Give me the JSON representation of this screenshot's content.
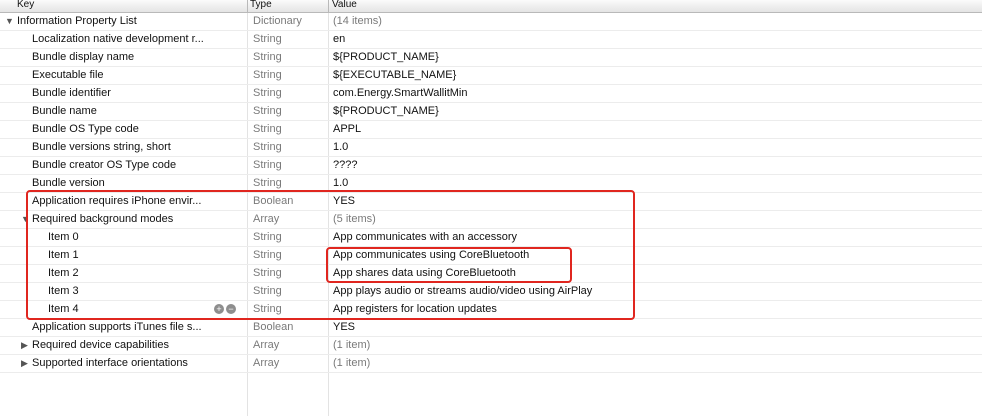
{
  "columns": {
    "key": "Key",
    "type": "Type",
    "value": "Value"
  },
  "rows": [
    {
      "key": "Information Property List",
      "type": "Dictionary",
      "value": "(14 items)"
    },
    {
      "key": "Localization native development r...",
      "type": "String",
      "value": "en"
    },
    {
      "key": "Bundle display name",
      "type": "String",
      "value": "${PRODUCT_NAME}"
    },
    {
      "key": "Executable file",
      "type": "String",
      "value": "${EXECUTABLE_NAME}"
    },
    {
      "key": "Bundle identifier",
      "type": "String",
      "value": "com.Energy.SmartWallitMin"
    },
    {
      "key": "Bundle name",
      "type": "String",
      "value": "${PRODUCT_NAME}"
    },
    {
      "key": "Bundle OS Type code",
      "type": "String",
      "value": "APPL"
    },
    {
      "key": "Bundle versions string, short",
      "type": "String",
      "value": "1.0"
    },
    {
      "key": "Bundle creator OS Type code",
      "type": "String",
      "value": "????"
    },
    {
      "key": "Bundle version",
      "type": "String",
      "value": "1.0"
    },
    {
      "key": "Application requires iPhone envir...",
      "type": "Boolean",
      "value": "YES"
    },
    {
      "key": "Required background modes",
      "type": "Array",
      "value": "(5 items)"
    },
    {
      "key": "Item 0",
      "type": "String",
      "value": "App communicates with an accessory"
    },
    {
      "key": "Item 1",
      "type": "String",
      "value": "App communicates using CoreBluetooth"
    },
    {
      "key": "Item 2",
      "type": "String",
      "value": "App shares data using CoreBluetooth"
    },
    {
      "key": "Item 3",
      "type": "String",
      "value": "App plays audio or streams audio/video using AirPlay"
    },
    {
      "key": "Item 4",
      "type": "String",
      "value": "App registers for location updates"
    },
    {
      "key": "Application supports iTunes file s...",
      "type": "Boolean",
      "value": "YES"
    },
    {
      "key": "Required device capabilities",
      "type": "Array",
      "value": "(1 item)"
    },
    {
      "key": "Supported interface orientations",
      "type": "Array",
      "value": "(1 item)"
    }
  ],
  "icons": {
    "expanded": "triangle-down-icon",
    "collapsed": "triangle-right-icon",
    "add": "plus-circle-icon",
    "remove": "minus-circle-icon"
  },
  "highlight_color": "#e0261f"
}
